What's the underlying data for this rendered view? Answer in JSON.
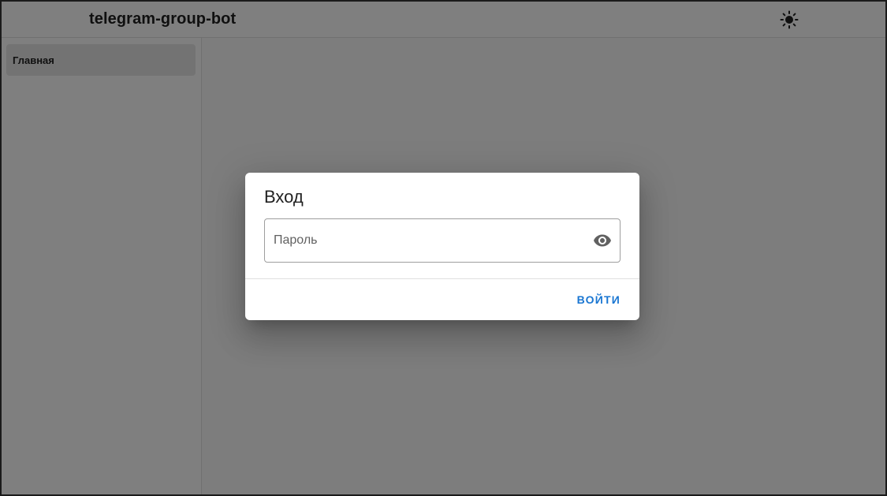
{
  "appbar": {
    "title": "telegram-group-bot",
    "theme_icon": "sun-icon"
  },
  "sidebar": {
    "items": [
      {
        "label": "Главная",
        "active": true
      }
    ]
  },
  "dialog": {
    "title": "Вход",
    "password_field": {
      "placeholder": "Пароль",
      "value": "",
      "toggle_icon": "eye-icon"
    },
    "submit_label": "ВОЙТИ"
  },
  "colors": {
    "accent": "#1976d2",
    "scrim": "rgba(0,0,0,0.5)",
    "text_primary": "#212121",
    "nav_active_bg": "#e6e6e6"
  }
}
